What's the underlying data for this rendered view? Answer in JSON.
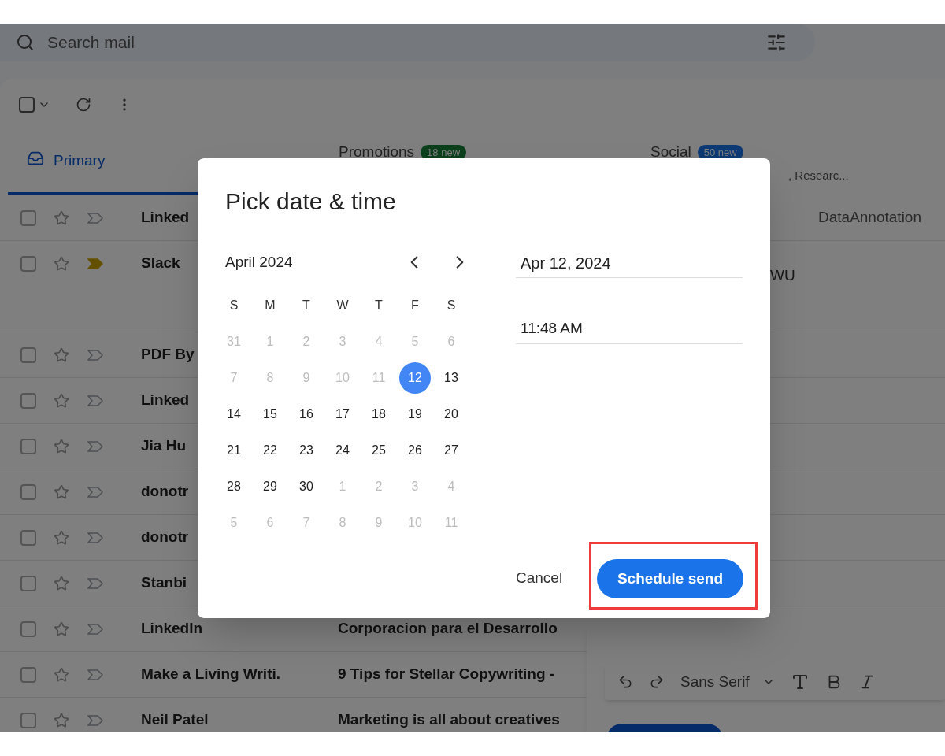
{
  "search": {
    "placeholder": "Search mail"
  },
  "select_all": {
    "checked": false
  },
  "tabs": [
    {
      "label": "Primary",
      "selected": true
    },
    {
      "label": "Promotions",
      "badge": "18 new",
      "color": "#0c401c",
      "selected": false
    },
    {
      "label": "Social",
      "badge": "50 new",
      "color": "#0d3a74",
      "subtitle": ", Researc...",
      "selected": false
    }
  ],
  "emails": [
    {
      "sender": "Linked",
      "snippet": "DataAnnotation",
      "important": false,
      "tall": false,
      "checked": false
    },
    {
      "sender": "Slack",
      "snippet": "WU",
      "important": true,
      "tall": true,
      "checked": false
    },
    {
      "sender": "PDF By",
      "important": false,
      "tall": false,
      "checked": false
    },
    {
      "sender": "Linked",
      "important": false,
      "tall": false,
      "checked": false
    },
    {
      "sender": "Jia Hu",
      "important": false,
      "tall": false,
      "checked": false
    },
    {
      "sender": "donotr",
      "important": false,
      "tall": false,
      "checked": false
    },
    {
      "sender": "donotr",
      "important": false,
      "tall": false,
      "checked": false
    },
    {
      "sender": "Stanbi",
      "important": false,
      "tall": false,
      "checked": false
    },
    {
      "sender": "LinkedIn",
      "subject": "Corporacion para el Desarrollo",
      "important": false,
      "tall": false,
      "checked": false
    },
    {
      "sender": "Make a Living Writi.",
      "subject": "9 Tips for Stellar Copywriting -",
      "important": false,
      "tall": false,
      "checked": false
    },
    {
      "sender": "Neil Patel",
      "subject": "Marketing is all about creatives",
      "important": false,
      "tall": false,
      "checked": false
    }
  ],
  "compose_toolbar": {
    "font": "Sans Serif"
  },
  "dialog": {
    "title": "Pick date & time",
    "month": "April 2024",
    "weekdays": [
      "S",
      "M",
      "T",
      "W",
      "T",
      "F",
      "S"
    ],
    "weeks": [
      [
        {
          "day": "31",
          "muted": true,
          "selected": false
        },
        {
          "day": "1",
          "muted": true,
          "selected": false
        },
        {
          "day": "2",
          "muted": true,
          "selected": false
        },
        {
          "day": "3",
          "muted": true,
          "selected": false
        },
        {
          "day": "4",
          "muted": true,
          "selected": false
        },
        {
          "day": "5",
          "muted": true,
          "selected": false
        },
        {
          "day": "6",
          "muted": true,
          "selected": false
        }
      ],
      [
        {
          "day": "7",
          "muted": true,
          "selected": false
        },
        {
          "day": "8",
          "muted": true,
          "selected": false
        },
        {
          "day": "9",
          "muted": true,
          "selected": false
        },
        {
          "day": "10",
          "muted": true,
          "selected": false
        },
        {
          "day": "11",
          "muted": true,
          "selected": false
        },
        {
          "day": "12",
          "muted": false,
          "selected": true
        },
        {
          "day": "13",
          "muted": false,
          "selected": false
        }
      ],
      [
        {
          "day": "14",
          "muted": false,
          "selected": false
        },
        {
          "day": "15",
          "muted": false,
          "selected": false
        },
        {
          "day": "16",
          "muted": false,
          "selected": false
        },
        {
          "day": "17",
          "muted": false,
          "selected": false
        },
        {
          "day": "18",
          "muted": false,
          "selected": false
        },
        {
          "day": "19",
          "muted": false,
          "selected": false
        },
        {
          "day": "20",
          "muted": false,
          "selected": false
        }
      ],
      [
        {
          "day": "21",
          "muted": false,
          "selected": false
        },
        {
          "day": "22",
          "muted": false,
          "selected": false
        },
        {
          "day": "23",
          "muted": false,
          "selected": false
        },
        {
          "day": "24",
          "muted": false,
          "selected": false
        },
        {
          "day": "25",
          "muted": false,
          "selected": false
        },
        {
          "day": "26",
          "muted": false,
          "selected": false
        },
        {
          "day": "27",
          "muted": false,
          "selected": false
        }
      ],
      [
        {
          "day": "28",
          "muted": false,
          "selected": false
        },
        {
          "day": "29",
          "muted": false,
          "selected": false
        },
        {
          "day": "30",
          "muted": false,
          "selected": false
        },
        {
          "day": "1",
          "muted": true,
          "selected": false
        },
        {
          "day": "2",
          "muted": true,
          "selected": false
        },
        {
          "day": "3",
          "muted": true,
          "selected": false
        },
        {
          "day": "4",
          "muted": true,
          "selected": false
        }
      ],
      [
        {
          "day": "5",
          "muted": true,
          "selected": false
        },
        {
          "day": "6",
          "muted": true,
          "selected": false
        },
        {
          "day": "7",
          "muted": true,
          "selected": false
        },
        {
          "day": "8",
          "muted": true,
          "selected": false
        },
        {
          "day": "9",
          "muted": true,
          "selected": false
        },
        {
          "day": "10",
          "muted": true,
          "selected": false
        },
        {
          "day": "11",
          "muted": true,
          "selected": false
        }
      ]
    ],
    "date": "Apr 12, 2024",
    "time": "11:48 AM",
    "cancel": "Cancel",
    "confirm": {
      "label": "Schedule send",
      "highlighted": true
    }
  }
}
